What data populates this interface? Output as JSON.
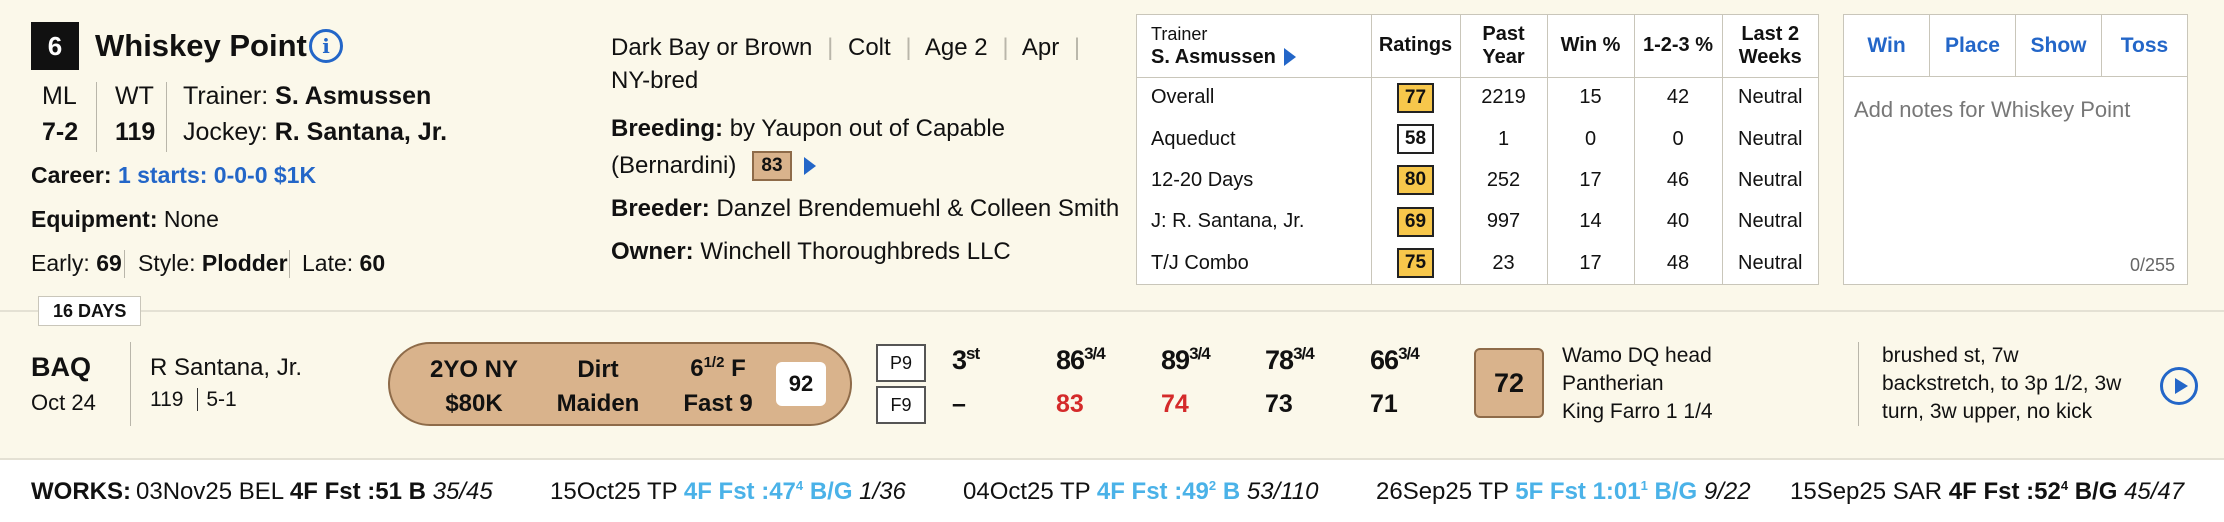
{
  "horse": {
    "number": "6",
    "name": "Whiskey Point",
    "ml_label": "ML",
    "ml": "7-2",
    "wt_label": "WT",
    "wt": "119",
    "trainer_label": "Trainer:",
    "trainer": "S. Asmussen",
    "jockey_label": "Jockey:",
    "jockey": "R. Santana, Jr.",
    "career_label": "Career:",
    "career": "1 starts: 0-0-0 $1K",
    "equipment_label": "Equipment:",
    "equipment": "None",
    "early_label": "Early:",
    "early": "69",
    "style_label": "Style:",
    "style": "Plodder",
    "late_label": "Late:",
    "late": "60"
  },
  "details": {
    "color": "Dark Bay or Brown",
    "sex": "Colt",
    "age": "Age 2",
    "month": "Apr",
    "bred": "NY-bred",
    "breeding_label": "Breeding:",
    "breeding_line1": "by Yaupon out of Capable",
    "breeding_line2": "(Bernardini)",
    "breeding_rating": "83",
    "breeder_label": "Breeder:",
    "breeder": "Danzel Brendemuehl & Colleen Smith",
    "owner_label": "Owner:",
    "owner": "Winchell Thoroughbreds LLC"
  },
  "ratings_table": {
    "trainer_label": "Trainer",
    "trainer_name": "S. Asmussen",
    "headers": [
      "Ratings",
      "Past Year",
      "Win %",
      "1-2-3 %",
      "Last 2 Weeks"
    ],
    "rows": [
      {
        "label": "Overall",
        "rating": "77",
        "rating_style": "yellow",
        "past_year": "2219",
        "win": "15",
        "itm": "42",
        "last2": "Neutral"
      },
      {
        "label": "Aqueduct",
        "rating": "58",
        "rating_style": "white",
        "past_year": "1",
        "win": "0",
        "itm": "0",
        "last2": "Neutral"
      },
      {
        "label": "12-20 Days",
        "rating": "80",
        "rating_style": "yellow",
        "past_year": "252",
        "win": "17",
        "itm": "46",
        "last2": "Neutral"
      },
      {
        "label": "J: R. Santana, Jr.",
        "rating": "69",
        "rating_style": "yellow",
        "past_year": "997",
        "win": "14",
        "itm": "40",
        "last2": "Neutral"
      },
      {
        "label": "T/J Combo",
        "rating": "75",
        "rating_style": "yellow",
        "past_year": "23",
        "win": "17",
        "itm": "48",
        "last2": "Neutral"
      }
    ]
  },
  "bet": {
    "tabs": [
      "Win",
      "Place",
      "Show",
      "Toss"
    ],
    "notes_placeholder": "Add notes for Whiskey Point",
    "notes_count": "0/255"
  },
  "past_performance": {
    "days_since": "16 DAYS",
    "track": "BAQ",
    "date": "Oct 24",
    "jockey": "R Santana, Jr.",
    "weight": "119",
    "odds": "5-1",
    "race_class_1": "2YO NY",
    "race_class_2": "$80K",
    "surface_1": "Dirt",
    "surface_2": "Maiden",
    "distance_whole": "6",
    "distance_frac": "1/2",
    "distance_unit": "F",
    "condition": "Fast 9",
    "speed_figure": "92",
    "post": "P9",
    "field": "F9",
    "calls": [
      {
        "pos": "3",
        "sup": "st",
        "len": "",
        "fig": "–",
        "fig_color": "black"
      },
      {
        "pos": "8",
        "sup": "",
        "len": "6",
        "frac": "3/4",
        "fig": "83",
        "fig_color": "red"
      },
      {
        "pos": "8",
        "sup": "",
        "len": "9",
        "frac": "3/4",
        "fig": "74",
        "fig_color": "red"
      },
      {
        "pos": "7",
        "sup": "",
        "len": "8",
        "frac": "3/4",
        "fig": "73",
        "fig_color": "black"
      },
      {
        "pos": "6",
        "sup": "",
        "len": "6",
        "frac": "3/4",
        "fig": "71",
        "fig_color": "black"
      }
    ],
    "final_figure": "72",
    "top_finishers": [
      "Wamo DQ head",
      "Pantherian",
      "King Farro  1 1/4"
    ],
    "comment": [
      "brushed st, 7w",
      "backstretch, to 3p 1/2, 3w",
      "turn, 3w upper, no kick"
    ]
  },
  "works": {
    "label": "WORKS:",
    "items": [
      {
        "date": "03Nov25 BEL",
        "dist": "4F Fst :51",
        "sup": "",
        "grade": "B",
        "rank": "35/45",
        "highlight": false
      },
      {
        "date": "15Oct25 TP",
        "dist": "4F Fst :47",
        "sup": "4",
        "grade": "B/G",
        "rank": "1/36",
        "highlight": true
      },
      {
        "date": "04Oct25 TP",
        "dist": "4F Fst :49",
        "sup": "2",
        "grade": "B",
        "rank": "53/110",
        "highlight": true
      },
      {
        "date": "26Sep25 TP",
        "dist": "5F Fst 1:01",
        "sup": "1",
        "grade": "B/G",
        "rank": "9/22",
        "highlight": true
      },
      {
        "date": "15Sep25 SAR",
        "dist": "4F Fst :52",
        "sup": "4",
        "grade": "B/G",
        "rank": "45/47",
        "highlight": false
      }
    ]
  }
}
